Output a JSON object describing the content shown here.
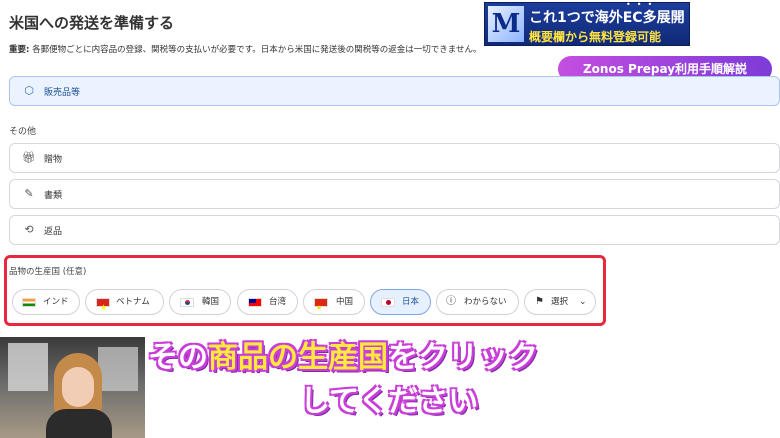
{
  "page": {
    "title": "米国への発送を準備する",
    "notice_bold": "重要:",
    "notice_text": " 各郵便物ごとに内容品の登録、関税等の支払いが必要です。日本から米国に発送後の関税等の返金は一切できません。"
  },
  "banner": {
    "logo_letter": "M",
    "line1": "これ1つで海外EC多展開",
    "line2": "概要欄から無料登録可能",
    "dots": "•••"
  },
  "tag": {
    "label": "Zonos Prepay利用手順解説"
  },
  "contents_options": [
    {
      "label": "販売品等",
      "icon": "package-icon",
      "selected": true
    }
  ],
  "other_section": {
    "label": "その他",
    "options": [
      {
        "label": "贈物",
        "icon": "gift-icon"
      },
      {
        "label": "書類",
        "icon": "document-icon"
      },
      {
        "label": "返品",
        "icon": "return-icon"
      }
    ]
  },
  "origin": {
    "label": "品物の生産国 (任意)",
    "chips": [
      {
        "label": "インド",
        "flag": "india-flag-icon"
      },
      {
        "label": "ベトナム",
        "flag": "vietnam-flag-icon"
      },
      {
        "label": "韓国",
        "flag": "korea-flag-icon"
      },
      {
        "label": "台湾",
        "flag": "taiwan-flag-icon"
      },
      {
        "label": "中国",
        "flag": "china-flag-icon"
      },
      {
        "label": "日本",
        "flag": "japan-flag-icon",
        "selected": true
      },
      {
        "label": "わからない",
        "icon": "question-circle-icon"
      },
      {
        "label": "選択",
        "icon": "flag-icon",
        "trailing_icon": "chevron-down-icon"
      }
    ]
  },
  "caption": {
    "line1_pre": "その",
    "line1_highlight": "商品の生産国",
    "line1_post": "をクリック",
    "line2": "してください"
  },
  "colors": {
    "highlight_box": "#e8283c",
    "selected_bg": "#eaf3ff",
    "caption_outline": "#c93fd8",
    "caption_highlight": "#ffe93a"
  }
}
